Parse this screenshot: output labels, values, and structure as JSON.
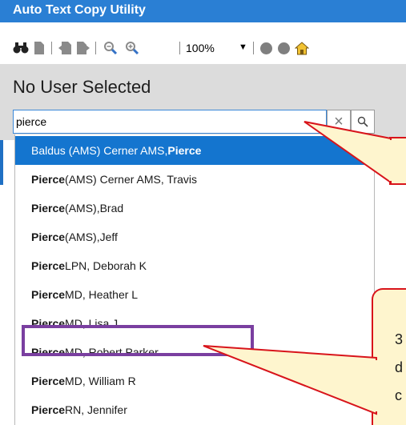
{
  "window": {
    "title": "Auto Text Copy Utility"
  },
  "toolbar": {
    "icons": [
      "binoculars-icon",
      "page-icon",
      "page-back-icon",
      "page-forward-icon",
      "zoom-out-icon",
      "zoom-in-icon",
      "circle-icon",
      "circle-icon",
      "home-icon"
    ],
    "zoom_value": "100%"
  },
  "header": {
    "title": "No User Selected"
  },
  "search": {
    "value": "pierce",
    "clear_icon": "close-icon",
    "search_icon": "search-icon"
  },
  "results": [
    {
      "pre": "Baldus (AMS) Cerner AMS, ",
      "bold": "Pierce",
      "post": "",
      "selected": true
    },
    {
      "pre": "",
      "bold": "Pierce",
      "post": " (AMS) Cerner AMS, Travis",
      "selected": false
    },
    {
      "pre": "",
      "bold": "Pierce",
      "post": " (AMS),Brad",
      "selected": false
    },
    {
      "pre": "",
      "bold": "Pierce",
      "post": " (AMS),Jeff",
      "selected": false
    },
    {
      "pre": "",
      "bold": "Pierce",
      "post": " LPN, Deborah K",
      "selected": false
    },
    {
      "pre": "",
      "bold": "Pierce",
      "post": " MD, Heather L",
      "selected": false
    },
    {
      "pre": "",
      "bold": "Pierce",
      "post": " MD, Lisa J",
      "selected": false
    },
    {
      "pre": "",
      "bold": "Pierce",
      "post": " MD, Robert Parker",
      "selected": false
    },
    {
      "pre": "",
      "bold": "Pierce",
      "post": " MD, William R",
      "selected": false
    },
    {
      "pre": "",
      "bold": "Pierce",
      "post": " RN, Jennifer",
      "selected": false
    }
  ],
  "annotations": {
    "highlighted_row": "Pierce MD, Robert Parker",
    "callout_lower_lines": [
      "3",
      "d",
      "c"
    ]
  },
  "colors": {
    "titlebar": "#2a7fd4",
    "selected_row": "#1475cf",
    "highlight_border": "#7a3fa0",
    "callout_fill": "#fef5ce",
    "callout_border": "#d8141b"
  }
}
